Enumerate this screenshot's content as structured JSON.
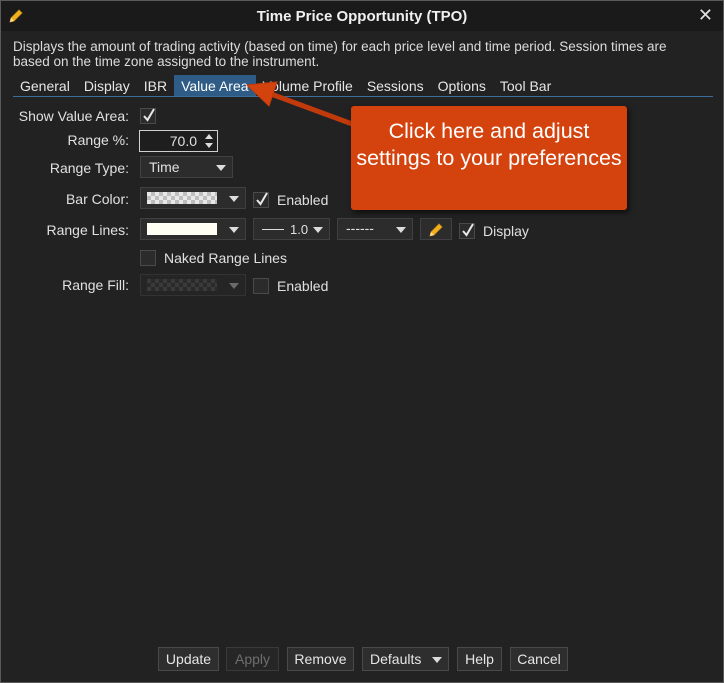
{
  "window": {
    "title": "Time Price Opportunity (TPO)",
    "close_glyph": "✕"
  },
  "description": "Displays the amount of trading activity (based on time) for each price level and time period. Session times are based on the time zone assigned to the instrument.",
  "tabs": [
    {
      "label": "General"
    },
    {
      "label": "Display"
    },
    {
      "label": "IBR"
    },
    {
      "label": "Value Area",
      "active": true
    },
    {
      "label": "Volume Profile"
    },
    {
      "label": "Sessions"
    },
    {
      "label": "Options"
    },
    {
      "label": "Tool Bar"
    }
  ],
  "settings": {
    "show_value_area": {
      "label": "Show Value Area:",
      "checked": true
    },
    "range_pct": {
      "label": "Range %:",
      "value": "70.0"
    },
    "range_type": {
      "label": "Range Type:",
      "value": "Time"
    },
    "bar_color": {
      "label": "Bar Color:",
      "enabled_label": "Enabled",
      "enabled": true
    },
    "range_lines": {
      "label": "Range Lines:",
      "width": "1.0",
      "style": "------",
      "display_label": "Display",
      "display": true
    },
    "naked_range_lines": {
      "label": "Naked Range Lines",
      "checked": false
    },
    "range_fill": {
      "label": "Range Fill:",
      "enabled_label": "Enabled",
      "enabled": false
    }
  },
  "callout": {
    "text": "Click here and adjust settings to your preferences",
    "color": "#d4430e"
  },
  "buttons": {
    "update": "Update",
    "apply": "Apply",
    "remove": "Remove",
    "defaults": "Defaults",
    "help": "Help",
    "cancel": "Cancel"
  },
  "colors": {
    "accent": "#2e5c86",
    "range_line_color": "#fffef2"
  }
}
